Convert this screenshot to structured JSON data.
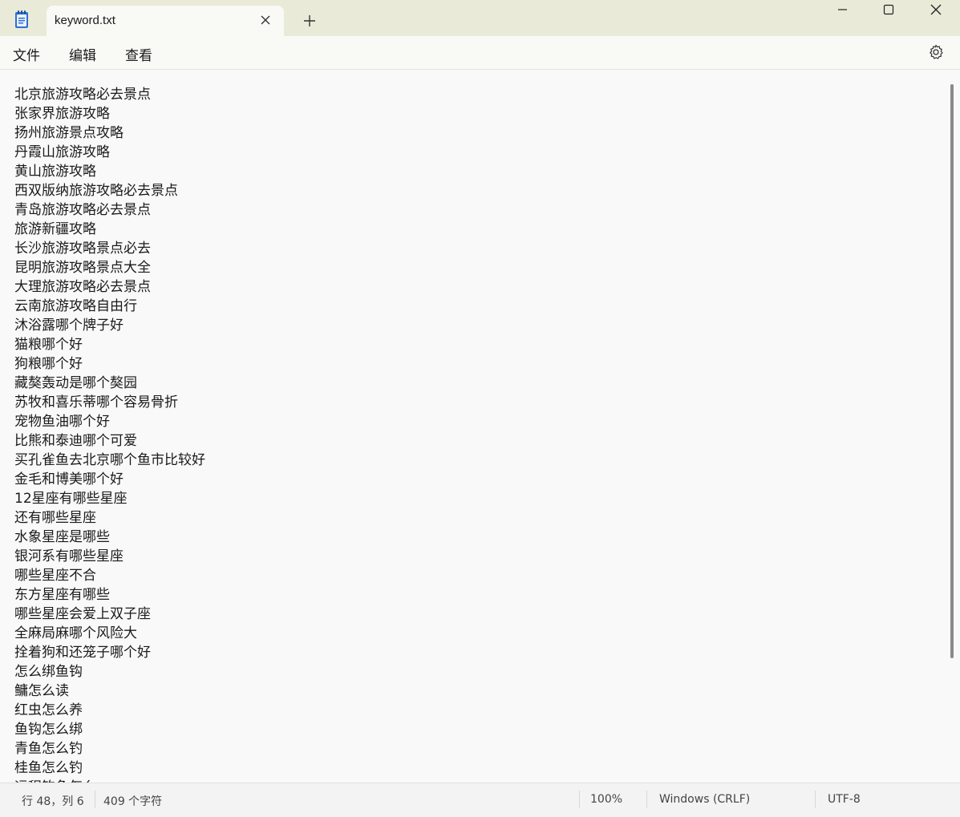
{
  "tab": {
    "title": "keyword.txt"
  },
  "menu": {
    "file": "文件",
    "edit": "编辑",
    "view": "查看"
  },
  "editor": {
    "lines": [
      "北京旅游攻略必去景点",
      "张家界旅游攻略",
      "扬州旅游景点攻略",
      "丹霞山旅游攻略",
      "黄山旅游攻略",
      "西双版纳旅游攻略必去景点",
      "青岛旅游攻略必去景点",
      "旅游新疆攻略",
      "长沙旅游攻略景点必去",
      "昆明旅游攻略景点大全",
      "大理旅游攻略必去景点",
      "云南旅游攻略自由行",
      "沐浴露哪个牌子好",
      "猫粮哪个好",
      "狗粮哪个好",
      "藏獒轰动是哪个獒园",
      "苏牧和喜乐蒂哪个容易骨折",
      "宠物鱼油哪个好",
      "比熊和泰迪哪个可爱",
      "买孔雀鱼去北京哪个鱼市比较好",
      "金毛和博美哪个好",
      "12星座有哪些星座",
      "还有哪些星座",
      "水象星座是哪些",
      "银河系有哪些星座",
      "哪些星座不合",
      "东方星座有哪些",
      "哪些星座会爱上双子座",
      "全麻局麻哪个风险大",
      "拴着狗和还笼子哪个好",
      "怎么绑鱼钩",
      "鳙怎么读",
      "红虫怎么养",
      "鱼钩怎么绑",
      "青鱼怎么钓",
      "桂鱼怎么钓",
      "远程钓鱼怎么"
    ]
  },
  "status": {
    "position": "行 48，列 6",
    "char_count": "409 个字符",
    "zoom": "100%",
    "line_ending": "Windows (CRLF)",
    "encoding": "UTF-8"
  },
  "colors": {
    "titlebar": "#e9ead8",
    "tab": "#f9f9f6",
    "editor_bg": "#f9f9f9",
    "icon_blue": "#2f6fd6"
  }
}
